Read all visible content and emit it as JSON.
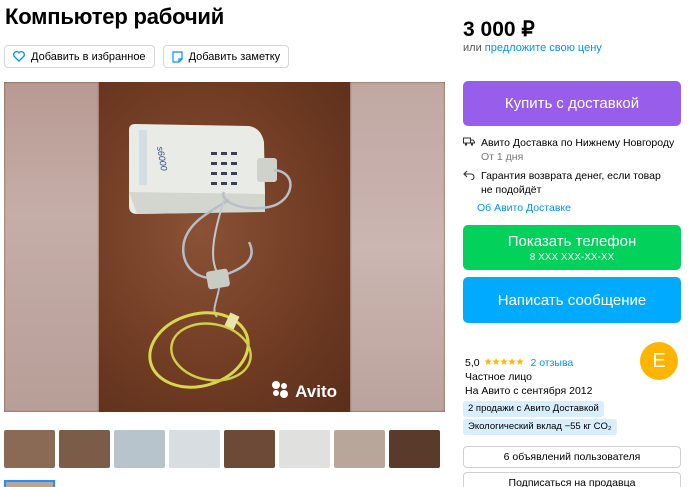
{
  "listing": {
    "title": "Компьютер рабочий",
    "favorite_label": "Добавить в избранное",
    "note_label": "Добавить заметку",
    "watermark": "Avito"
  },
  "price": {
    "amount": "3 000 ₽",
    "prefix": "или",
    "offer_link": "предложите свою цену"
  },
  "buy_button": "Купить с доставкой",
  "delivery": {
    "line1": "Авито Доставка по Нижнему Новгороду",
    "line1_sub": "От 1 дня",
    "line2": "Гарантия возврата денег, если товар не подойдёт",
    "about_link": "Об Авито Доставке"
  },
  "phone_button": {
    "label": "Показать телефон",
    "number": "8 XXX XXX-XX-XX"
  },
  "message_button": "Написать сообщение",
  "seller": {
    "rating": "5,0",
    "stars": "★★★★★",
    "reviews": "2 отзыва",
    "type": "Частное лицо",
    "since": "На Авито с сентября 2012",
    "badge1": "2 продажи с Авито Доставкой",
    "badge2": "Экологический вклад −55 кг CO₂",
    "avatar_letter": "E",
    "listings_button": "6 объявлений пользователя",
    "subscribe_button": "Подписаться на продавца"
  },
  "colors": {
    "buy": "#965eeb",
    "phone": "#02d15c",
    "message": "#00aaff",
    "link": "#0091ff",
    "avatar": "#ffb400"
  },
  "thumbnails": [
    {
      "name": "thumb-monitor-1",
      "color": "#8a6a55"
    },
    {
      "name": "thumb-monitor-2",
      "color": "#7a5c48"
    },
    {
      "name": "thumb-screen",
      "color": "#b7c4cc"
    },
    {
      "name": "thumb-panel",
      "color": "#d8dde2"
    },
    {
      "name": "thumb-mouse",
      "color": "#6d4a38"
    },
    {
      "name": "thumb-keyboard",
      "color": "#e0e0de"
    },
    {
      "name": "thumb-tower",
      "color": "#b9a69a"
    },
    {
      "name": "thumb-scanner",
      "color": "#5a3a2a"
    }
  ]
}
